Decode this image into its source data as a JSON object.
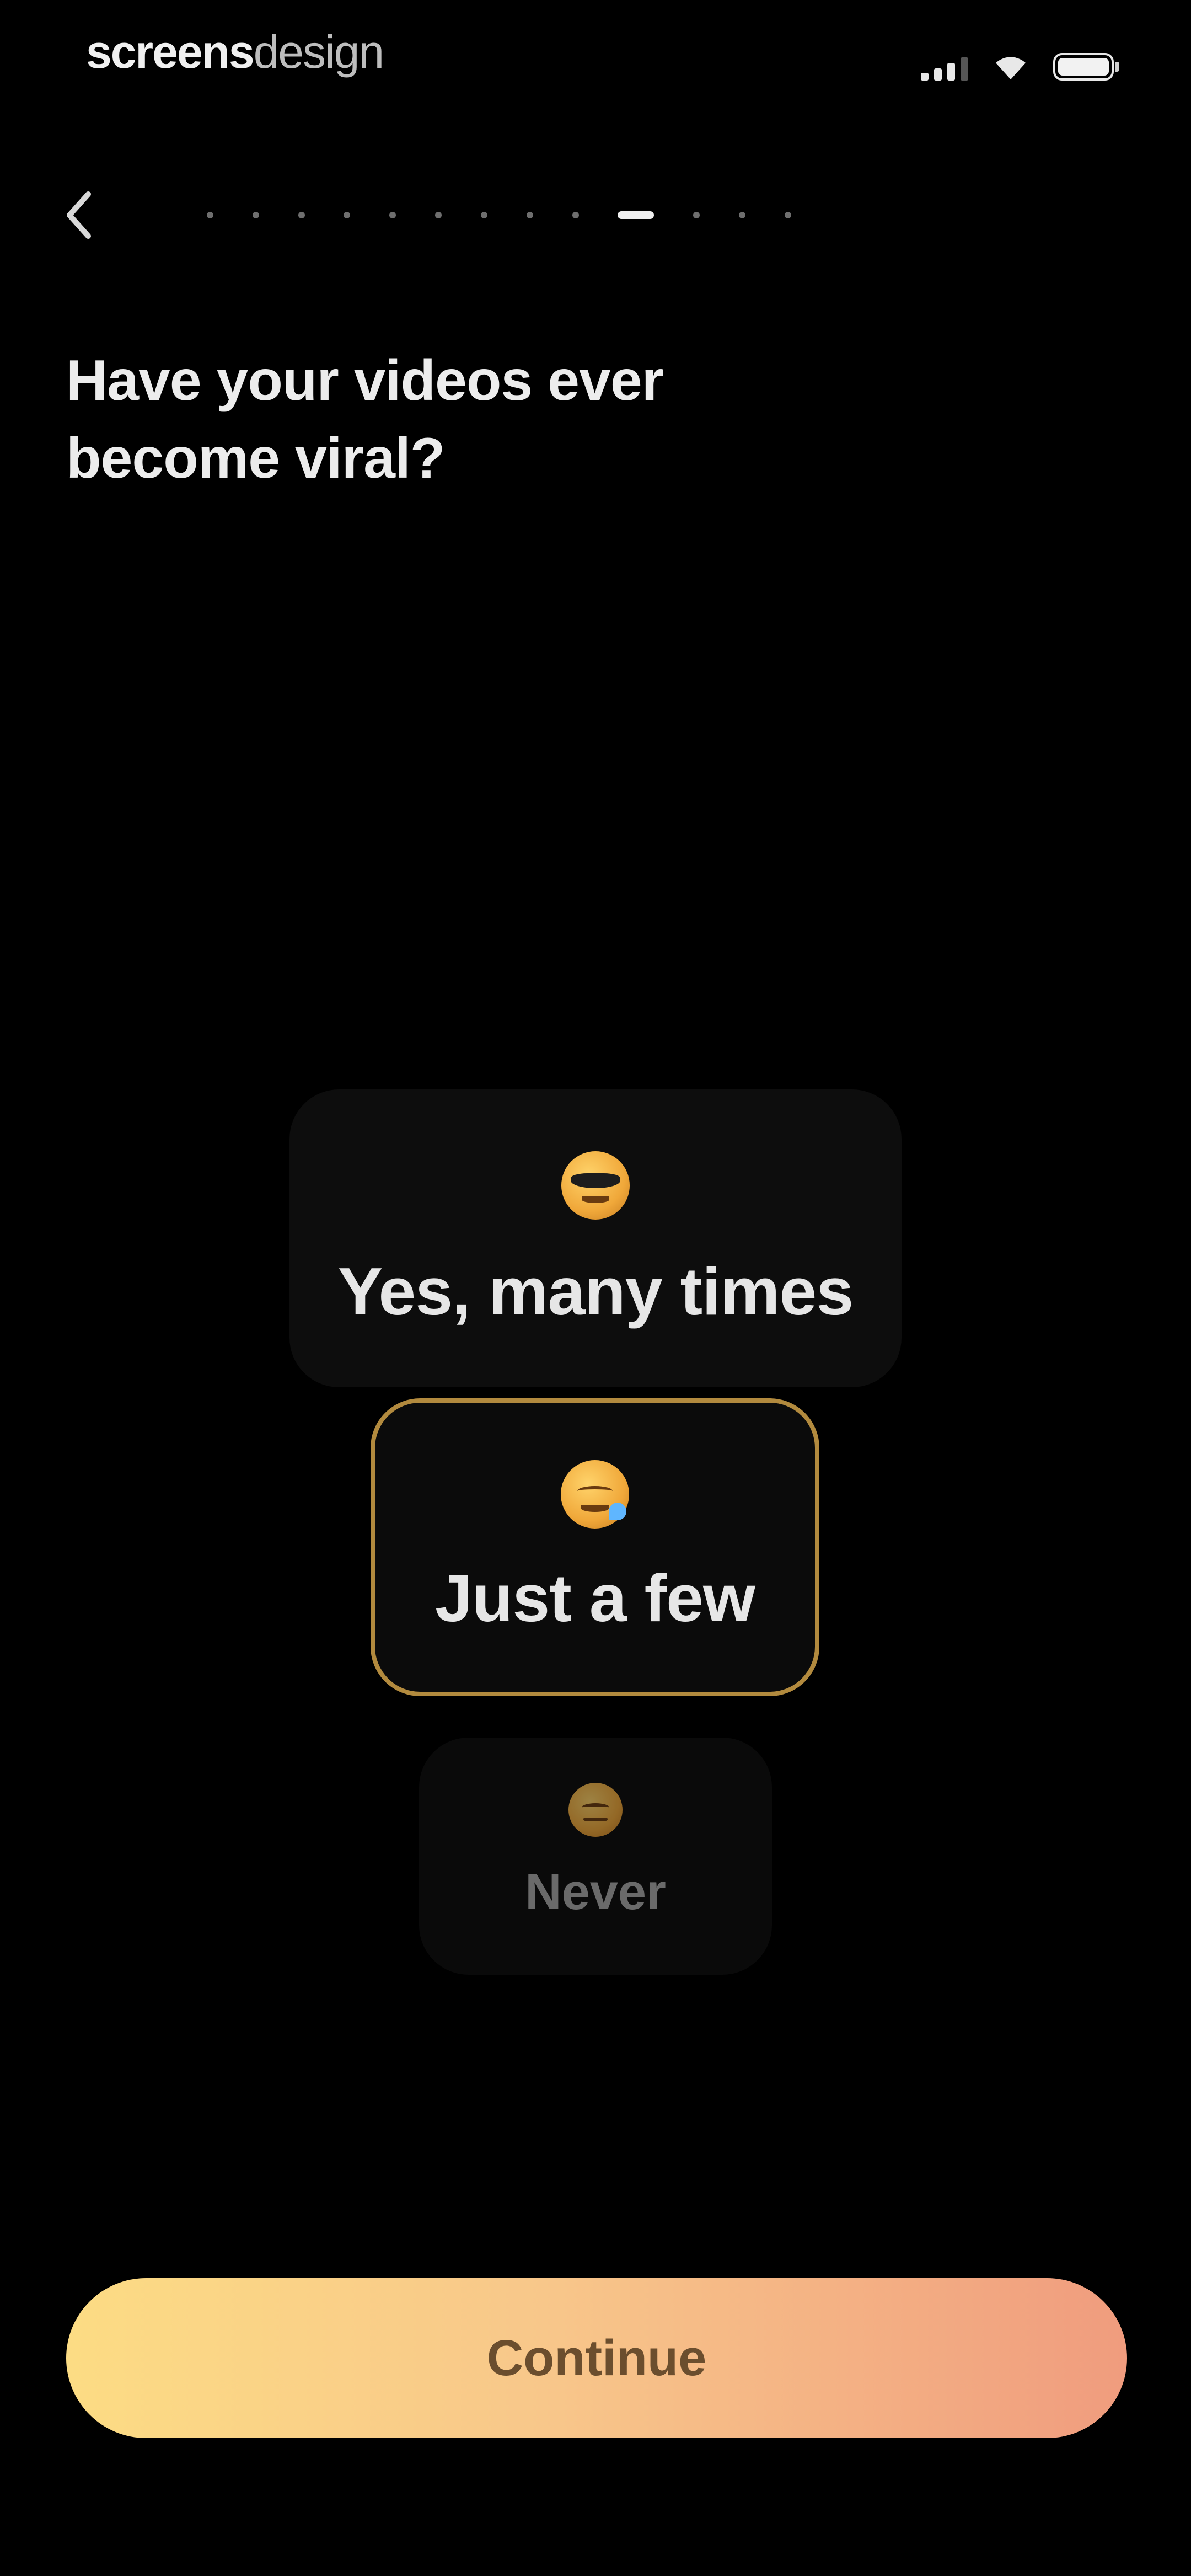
{
  "status_bar": {
    "brand_bold": "screens",
    "brand_light": "design",
    "icons": [
      "cellular-signal-icon",
      "wifi-icon",
      "battery-icon"
    ]
  },
  "navigation": {
    "back_icon": "chevron-left-icon",
    "progress": {
      "total_steps": 13,
      "current_step": 10
    }
  },
  "question": {
    "text": "Have your videos ever become viral?"
  },
  "options": [
    {
      "id": "many",
      "emoji": "😎",
      "icon": "sunglasses-face-icon",
      "label": "Yes, many times",
      "selected": false
    },
    {
      "id": "few",
      "emoji": "😅",
      "icon": "sweat-smile-face-icon",
      "label": "Just a few",
      "selected": true
    },
    {
      "id": "never",
      "emoji": "😑",
      "icon": "expressionless-face-icon",
      "label": "Never",
      "selected": false
    }
  ],
  "continue_button": {
    "label": "Continue"
  },
  "colors": {
    "background": "#000000",
    "selected_border": "#b28a3e",
    "button_gradient_start": "#fcdc84",
    "button_gradient_end": "#f09c7e"
  }
}
